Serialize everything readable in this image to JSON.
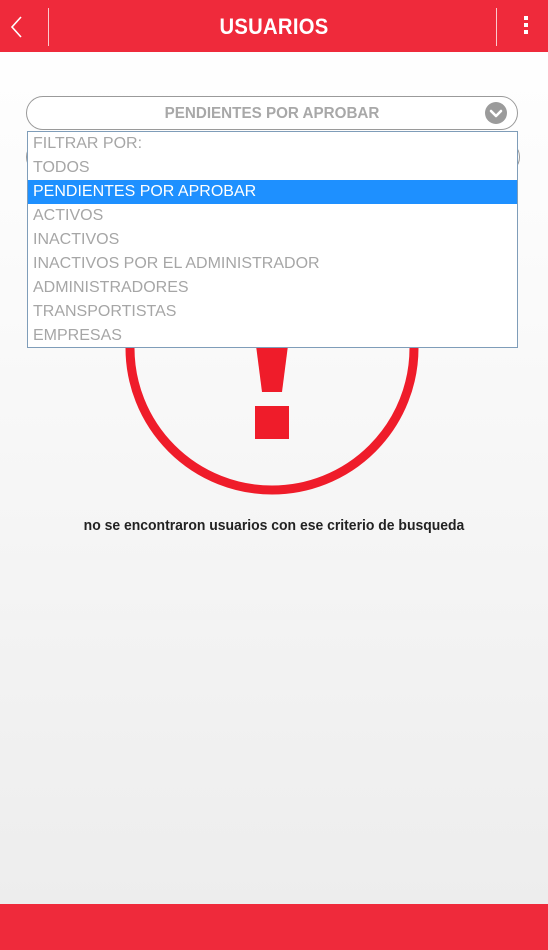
{
  "header": {
    "title": "USUARIOS",
    "back_icon": "chevron-left-icon",
    "menu_icon": "kebab-menu-icon",
    "bar_color": "#ef2a3b"
  },
  "filter": {
    "selected_value": "PENDIENTES POR APROBAR",
    "dropdown_icon": "chevron-down-circle-icon",
    "options": [
      "FILTRAR POR:",
      "TODOS",
      "PENDIENTES POR APROBAR",
      "ACTIVOS",
      "INACTIVOS",
      "INACTIVOS POR EL ADMINISTRADOR",
      "ADMINISTRADORES",
      "TRANSPORTISTAS",
      "EMPRESAS"
    ],
    "highlight_color": "#1e90ff"
  },
  "empty_state": {
    "icon": "alert-exclamation-icon",
    "message": "no se encontraron usuarios con ese criterio de busqueda",
    "icon_color": "#ef1c2a"
  }
}
